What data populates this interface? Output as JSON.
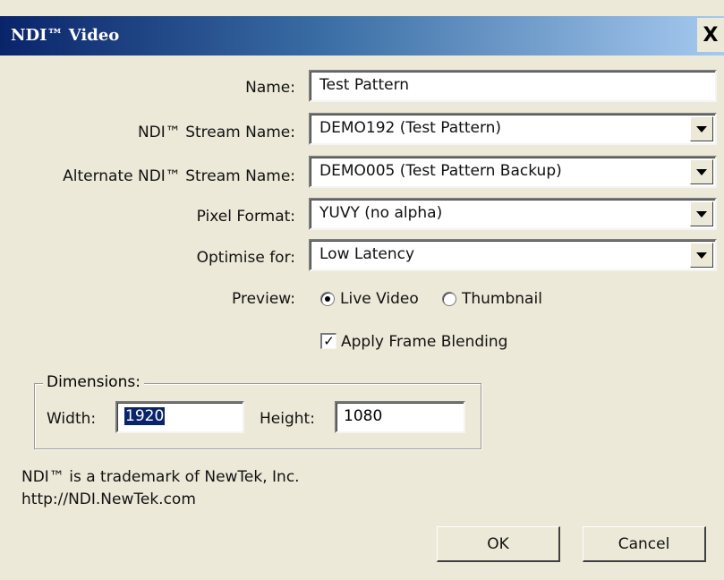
{
  "window": {
    "title": "NDI™ Video",
    "close_glyph": "X"
  },
  "form": {
    "name_label": "Name:",
    "name_value": "Test Pattern",
    "stream_label": "NDI™ Stream Name:",
    "stream_value": "DEMO192 (Test Pattern)",
    "alt_stream_label": "Alternate NDI™ Stream Name:",
    "alt_stream_value": "DEMO005 (Test Pattern Backup)",
    "pixel_format_label": "Pixel Format:",
    "pixel_format_value": "YUVY (no alpha)",
    "optimise_label": "Optimise for:",
    "optimise_value": "Low Latency",
    "preview_label": "Preview:",
    "preview_options": [
      "Live Video",
      "Thumbnail"
    ],
    "preview_selected": "Live Video",
    "frame_blending_label": "Apply Frame Blending",
    "frame_blending_checked": true
  },
  "dimensions": {
    "legend": "Dimensions:",
    "width_label": "Width:",
    "width_value": "1920",
    "height_label": "Height:",
    "height_value": "1080"
  },
  "footer": {
    "trademark": "NDI™ is a trademark of NewTek, Inc.",
    "url": "http://NDI.NewTek.com"
  },
  "buttons": {
    "ok": "OK",
    "cancel": "Cancel"
  },
  "colors": {
    "titlebar_start": "#0a246a",
    "titlebar_end": "#a6caf0",
    "dialog_bg": "#ece9d8",
    "selection": "#0a246a"
  }
}
